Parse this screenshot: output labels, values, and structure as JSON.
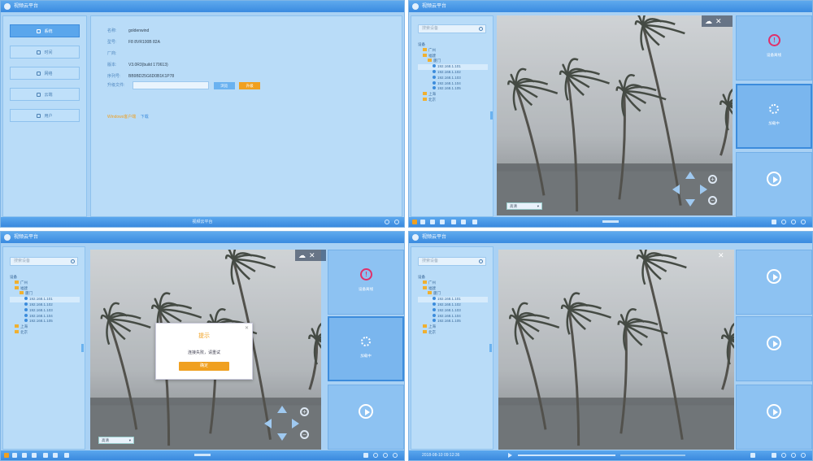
{
  "app": {
    "title": "视频云平台"
  },
  "q1": {
    "nav": [
      "系统",
      "时间",
      "网络",
      "云端",
      "用户"
    ],
    "fields": [
      {
        "label": "名称:",
        "value": "goldenwind"
      },
      {
        "label": "型号:",
        "value": "F8 8VR100B 82A"
      },
      {
        "label": "厂商:",
        "value": ""
      },
      {
        "label": "版本:",
        "value": "V3.0R3(build 170613)"
      },
      {
        "label": "序列号:",
        "value": "BB9BD25G6D0B1K1P78"
      }
    ],
    "upgrade_label": "升级文件:",
    "browse_label": "浏览",
    "upgrade_button": "升级",
    "link_text": "Windows客户端",
    "link_action": "下载",
    "status_text": "视频云平台"
  },
  "tree": {
    "search_placeholder": "搜索设备",
    "root": "设备",
    "items": [
      {
        "text": "广州",
        "type": "folder",
        "indent": 1
      },
      {
        "text": "福建",
        "type": "folder",
        "indent": 1
      },
      {
        "text": "厦门",
        "type": "folder",
        "indent": 2
      },
      {
        "text": "192.168.1.101",
        "type": "cam",
        "indent": 3
      },
      {
        "text": "192.168.1.102",
        "type": "cam",
        "indent": 3
      },
      {
        "text": "192.168.1.103",
        "type": "cam",
        "indent": 3
      },
      {
        "text": "192.168.1.104",
        "type": "cam",
        "indent": 3
      },
      {
        "text": "192.168.1.105",
        "type": "cam",
        "indent": 3
      },
      {
        "text": "上海",
        "type": "folder",
        "indent": 1
      },
      {
        "text": "北京",
        "type": "folder",
        "indent": 1
      }
    ]
  },
  "slots": {
    "offline_caption": "设备离线",
    "loading_caption": "加载中"
  },
  "stream": {
    "quality": "高清"
  },
  "dialog": {
    "title": "提示",
    "message": "连接失败，请重试",
    "ok": "确定"
  },
  "q4": {
    "timestamp": "2018-08-10 09:12:36"
  },
  "colors": {
    "accent": "#3c8cdc",
    "warning": "#f0a020",
    "alert": "#e0306a"
  }
}
